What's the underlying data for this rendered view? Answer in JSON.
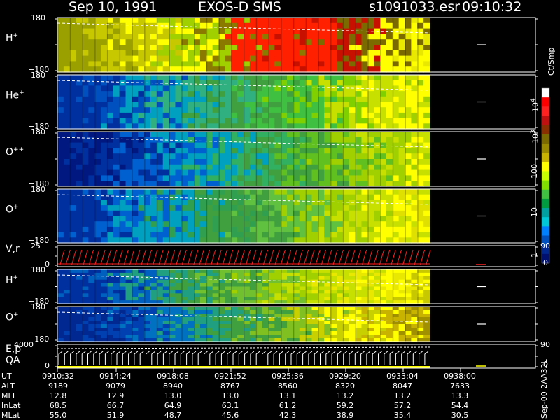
{
  "header": {
    "date": "Sep 10, 1991",
    "instrument": "EXOS-D SMS",
    "file": "s1091033.esr",
    "time": "09:10:32"
  },
  "panels": [
    {
      "id": "h",
      "label": "H",
      "sup": "+",
      "ymax": "180",
      "ymin": "−180"
    },
    {
      "id": "he",
      "label": "He",
      "sup": "+",
      "ymax": "180",
      "ymin": "−180"
    },
    {
      "id": "opp",
      "label": "O",
      "sup": "++",
      "ymax": "180",
      "ymin": "−180"
    },
    {
      "id": "op",
      "label": "O",
      "sup": "+",
      "ymax": "180",
      "ymin": "−180"
    },
    {
      "id": "vr",
      "label": "V,r",
      "sup": "",
      "ymax": "25",
      "ymin": "0",
      "rmax": "90",
      "rmin": "0"
    },
    {
      "id": "h2",
      "label": "H",
      "sup": "+",
      "ymax": "180",
      "ymin": "−180"
    },
    {
      "id": "o2",
      "label": "O",
      "sup": "+",
      "ymax": "180",
      "ymin": "−180"
    },
    {
      "id": "ep",
      "label": "E,p",
      "label2": "QA",
      "sup": "",
      "ymax": "4000",
      "ymin": "0",
      "rmax": "90",
      "rmin": "0"
    }
  ],
  "colorbar": {
    "unit": "Ct/Smp",
    "ticks": [
      {
        "base": "10",
        "exp": "4"
      },
      {
        "base": "10",
        "exp": "3"
      },
      {
        "base": "100",
        "exp": ""
      },
      {
        "base": "10",
        "exp": ""
      },
      {
        "base": "1",
        "exp": ""
      }
    ],
    "colors": [
      "#ffffff",
      "#ff0000",
      "#ff2020",
      "#c01010",
      "#8a3000",
      "#7a6a00",
      "#9a8a00",
      "#c8b400",
      "#ffff00",
      "#c8ff00",
      "#80e000",
      "#40c040",
      "#009a40",
      "#00a0a0",
      "#00c8d8",
      "#0080ff",
      "#0050c0",
      "#002890",
      "#001070"
    ]
  },
  "footer": {
    "rows": [
      {
        "name": "UT",
        "values": [
          "0910:32",
          "0914:24",
          "0918:08",
          "0921:52",
          "0925:36",
          "0929:20",
          "0933:04",
          "0938:00"
        ]
      },
      {
        "name": "ALT",
        "values": [
          "9189",
          "9079",
          "8940",
          "8767",
          "8560",
          "8320",
          "8047",
          "7633"
        ]
      },
      {
        "name": "MLT",
        "values": [
          "12.8",
          "12.9",
          "13.0",
          "13.0",
          "13.1",
          "13.2",
          "13.2",
          "13.3"
        ]
      },
      {
        "name": "InLat",
        "values": [
          "68.5",
          "66.7",
          "64.9",
          "63.1",
          "61.2",
          "59.2",
          "57.2",
          "54.4"
        ]
      },
      {
        "name": "MLat",
        "values": [
          "55.0",
          "51.9",
          "48.7",
          "45.6",
          "42.3",
          "38.9",
          "35.4",
          "30.5"
        ]
      }
    ],
    "stamp": "Sep-00  2AA32L"
  }
}
